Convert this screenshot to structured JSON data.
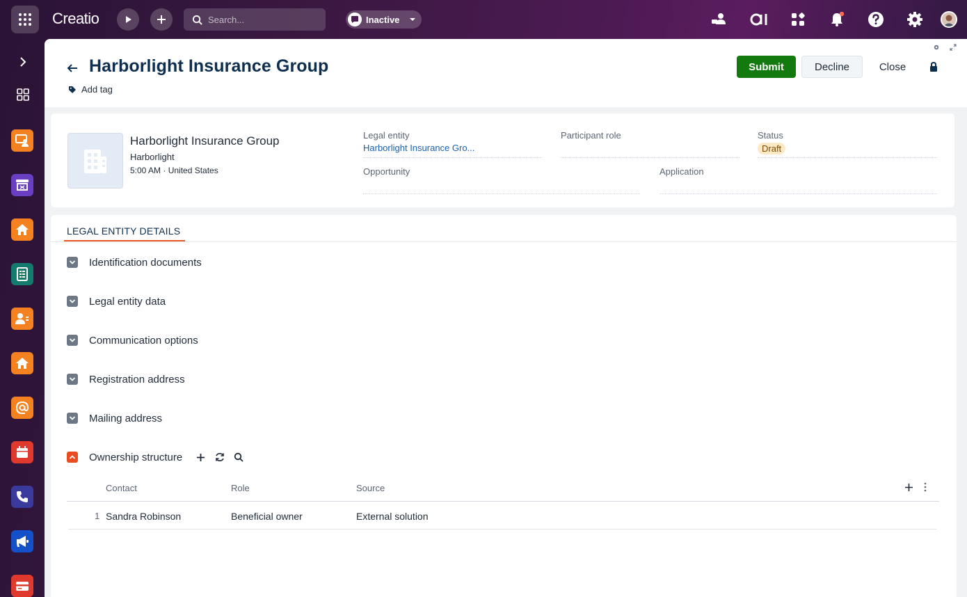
{
  "topbar": {
    "logo": "Creatio",
    "search_placeholder": "Search...",
    "status_label": "Inactive",
    "icons": [
      "apps-grid-icon",
      "play-icon",
      "plus-icon",
      "search-icon",
      "chat-icon",
      "caret-down-icon",
      "agent-icon",
      "ai-icon",
      "app-hub-icon",
      "bell-icon",
      "help-icon",
      "settings-icon",
      "user-avatar"
    ]
  },
  "rail": {
    "items": [
      "expand-icon",
      "dashboard-icon",
      "lead-app",
      "store-app",
      "home-app",
      "form-app",
      "contact-app",
      "home-app-2",
      "email-app",
      "calendar-app",
      "phone-app",
      "campaign-app",
      "card-app"
    ],
    "colors": {
      "orange": "#f58220",
      "purple": "#6a3fc4",
      "teal": "#147b6e",
      "red": "#e03a2e",
      "navy": "#3a3a9c",
      "blue": "#1450c8"
    }
  },
  "header": {
    "title": "Harborlight Insurance Group",
    "add_tag": "Add tag",
    "submit_label": "Submit",
    "decline_label": "Decline",
    "close_label": "Close",
    "accent_green": "#127a0e"
  },
  "profile": {
    "name": "Harborlight Insurance Group",
    "short_name": "Harborlight",
    "time_location": "5:00 AM · United States",
    "fields": {
      "legal_entity_label": "Legal entity",
      "legal_entity_value": "Harborlight Insurance Gro...",
      "participant_role_label": "Participant role",
      "participant_role_value": "",
      "status_label": "Status",
      "status_value": "Draft",
      "opportunity_label": "Opportunity",
      "opportunity_value": "",
      "application_label": "Application",
      "application_value": ""
    }
  },
  "details": {
    "tab_label": "LEGAL ENTITY DETAILS",
    "groups": [
      "Identification documents",
      "Legal entity data",
      "Communication options",
      "Registration address",
      "Mailing address",
      "Ownership structure"
    ],
    "ownership": {
      "columns": [
        "Contact",
        "Role",
        "Source"
      ],
      "rows": [
        {
          "num": "1",
          "contact": "Sandra Robinson",
          "role": "Beneficial owner",
          "source": "External solution"
        }
      ]
    }
  }
}
